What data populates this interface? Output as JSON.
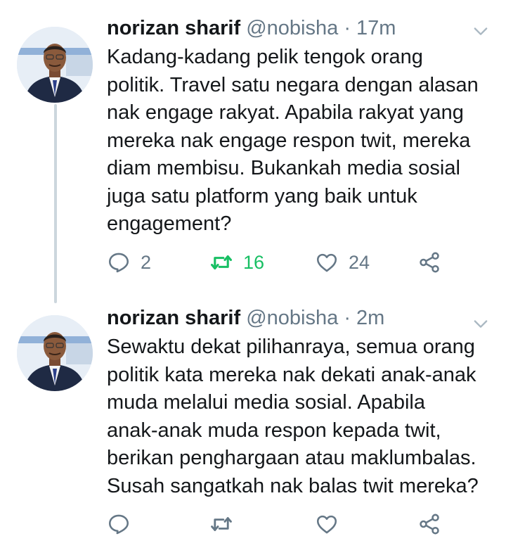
{
  "colors": {
    "text": "#14171a",
    "secondary": "#657786",
    "retweet_active": "#17bf63",
    "thread_line": "#ccd6dd"
  },
  "tweets": [
    {
      "name": "norizan sharif",
      "handle": "@nobisha",
      "separator": "·",
      "time": "17m",
      "text": "Kadang-kadang pelik tengok orang\npolitik. Travel satu negara dengan alasan\nnak engage rakyat. Apabila rakyat yang\nmereka nak engage respon twit, mereka\ndiam membisu. Bukankah media sosial\njuga satu platform yang baik untuk\nengagement?",
      "replies": "2",
      "retweets": "16",
      "likes": "24",
      "retweeted": true,
      "icons": [
        "reply-icon",
        "retweet-icon",
        "like-icon",
        "share-icon",
        "chevron-down-icon"
      ]
    },
    {
      "name": "norizan sharif",
      "handle": "@nobisha",
      "separator": "·",
      "time": "2m",
      "text": "Sewaktu dekat pilihanraya, semua orang\npolitik kata mereka nak dekati anak-anak\nmuda melalui media sosial. Apabila\nanak-anak muda respon kepada twit,\nberikan penghargaan atau maklumbalas.\nSusah sangatkah nak balas twit mereka?",
      "replies": "",
      "retweets": "",
      "likes": "",
      "retweeted": false,
      "icons": [
        "reply-icon",
        "retweet-icon",
        "like-icon",
        "share-icon",
        "chevron-down-icon"
      ]
    }
  ]
}
